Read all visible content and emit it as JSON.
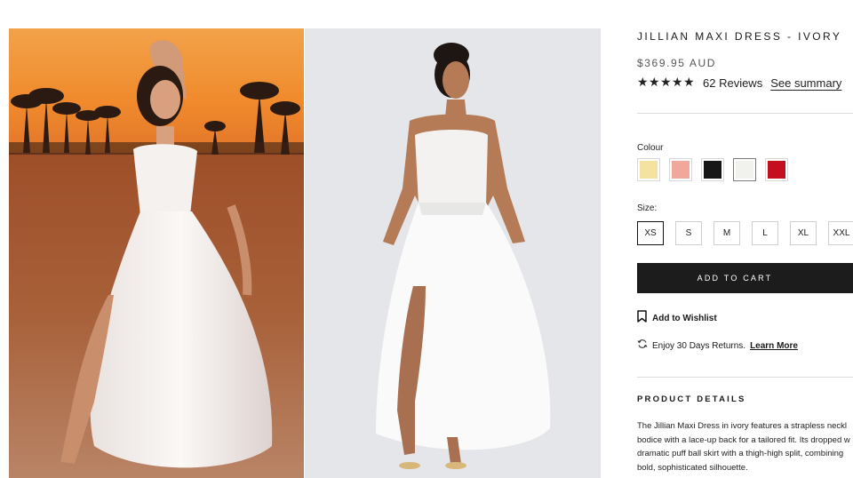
{
  "product": {
    "title": "JILLIAN MAXI DRESS - IVORY",
    "price": "$369.95 AUD",
    "rating_stars": 5,
    "reviews_label": "62 Reviews",
    "summary_link": "See summary"
  },
  "colour": {
    "label": "Colour",
    "swatches": [
      {
        "name": "butter",
        "color": "#f3e2a0",
        "selected": false
      },
      {
        "name": "pink",
        "color": "#f2a79b",
        "selected": false
      },
      {
        "name": "black",
        "color": "#161616",
        "selected": false
      },
      {
        "name": "ivory",
        "color": "#f1f1ee",
        "selected": true
      },
      {
        "name": "red",
        "color": "#c4101e",
        "selected": false
      }
    ]
  },
  "size": {
    "label": "Size:",
    "options": [
      "XS",
      "S",
      "M",
      "L",
      "XL",
      "XXL"
    ],
    "selected": "XS"
  },
  "actions": {
    "add_to_cart": "ADD TO CART",
    "wishlist": "Add to Wishlist",
    "returns_text": "Enjoy 30 Days Returns.",
    "returns_link": "Learn More"
  },
  "details": {
    "heading": "PRODUCT DETAILS",
    "lines": [
      "The Jillian Maxi Dress in ivory features a strapless neckl",
      "bodice with a lace-up back for a tailored fit. Its dropped w",
      "dramatic puff ball skirt with a thigh-high split, combining",
      "bold, sophisticated silhouette."
    ]
  },
  "icons": {
    "star": "star-icon",
    "wishlist": "bookmark-icon",
    "returns": "refresh-icon"
  }
}
